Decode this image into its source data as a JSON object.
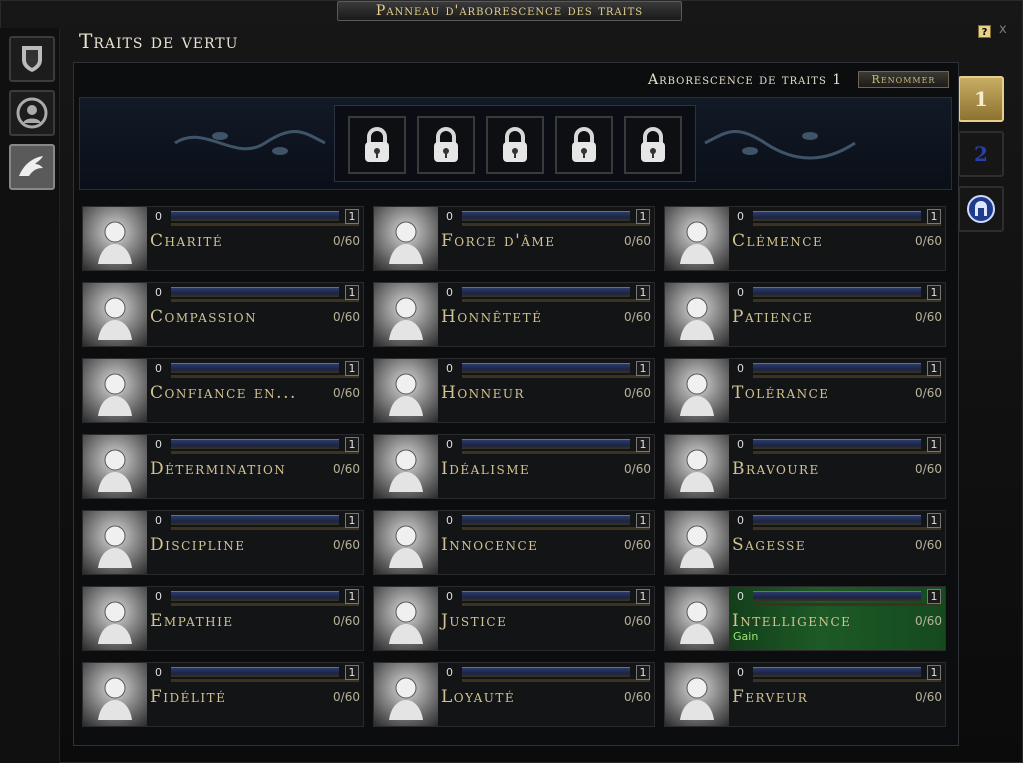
{
  "window": {
    "title": "Panneau d'arborescence des traits",
    "help_label": "?",
    "close_label": "x"
  },
  "heading": "Traits de vertu",
  "tree": {
    "name": "Arborescence de traits 1",
    "rename_label": "Renommer"
  },
  "left_tabs": [
    {
      "icon": "shield-icon"
    },
    {
      "icon": "portrait-icon"
    },
    {
      "icon": "eagle-icon",
      "active": true
    }
  ],
  "right_tabs": [
    {
      "label": "1",
      "active": true
    },
    {
      "label": "2"
    },
    {
      "icon": "helmet-icon"
    }
  ],
  "slots": [
    {
      "icon": "padlock-icon"
    },
    {
      "icon": "padlock-icon"
    },
    {
      "icon": "padlock-icon"
    },
    {
      "icon": "padlock-icon"
    },
    {
      "icon": "padlock-icon"
    }
  ],
  "traits": [
    {
      "name": "Charité",
      "rank_min": "0",
      "rank_next": "1",
      "count": "0/60"
    },
    {
      "name": "Force d'âme",
      "rank_min": "0",
      "rank_next": "1",
      "count": "0/60"
    },
    {
      "name": "Clémence",
      "rank_min": "0",
      "rank_next": "1",
      "count": "0/60"
    },
    {
      "name": "Compassion",
      "rank_min": "0",
      "rank_next": "1",
      "count": "0/60"
    },
    {
      "name": "Honnêteté",
      "rank_min": "0",
      "rank_next": "1",
      "count": "0/60"
    },
    {
      "name": "Patience",
      "rank_min": "0",
      "rank_next": "1",
      "count": "0/60"
    },
    {
      "name": "Confiance en...",
      "rank_min": "0",
      "rank_next": "1",
      "count": "0/60"
    },
    {
      "name": "Honneur",
      "rank_min": "0",
      "rank_next": "1",
      "count": "0/60"
    },
    {
      "name": "Tolérance",
      "rank_min": "0",
      "rank_next": "1",
      "count": "0/60"
    },
    {
      "name": "Détermination",
      "rank_min": "0",
      "rank_next": "1",
      "count": "0/60"
    },
    {
      "name": "Idéalisme",
      "rank_min": "0",
      "rank_next": "1",
      "count": "0/60"
    },
    {
      "name": "Bravoure",
      "rank_min": "0",
      "rank_next": "1",
      "count": "0/60"
    },
    {
      "name": "Discipline",
      "rank_min": "0",
      "rank_next": "1",
      "count": "0/60"
    },
    {
      "name": "Innocence",
      "rank_min": "0",
      "rank_next": "1",
      "count": "0/60"
    },
    {
      "name": "Sagesse",
      "rank_min": "0",
      "rank_next": "1",
      "count": "0/60"
    },
    {
      "name": "Empathie",
      "rank_min": "0",
      "rank_next": "1",
      "count": "0/60"
    },
    {
      "name": "Justice",
      "rank_min": "0",
      "rank_next": "1",
      "count": "0/60"
    },
    {
      "name": "Intelligence",
      "rank_min": "0",
      "rank_next": "1",
      "count": "0/60",
      "note": "Gain",
      "highlighted": true
    },
    {
      "name": "Fidélité",
      "rank_min": "0",
      "rank_next": "1",
      "count": "0/60"
    },
    {
      "name": "Loyauté",
      "rank_min": "0",
      "rank_next": "1",
      "count": "0/60"
    },
    {
      "name": "Ferveur",
      "rank_min": "0",
      "rank_next": "1",
      "count": "0/60"
    }
  ],
  "colors": {
    "accent_gold": "#d2c392",
    "gain_green": "#9ee67a",
    "banner_blue": "#121a27"
  }
}
